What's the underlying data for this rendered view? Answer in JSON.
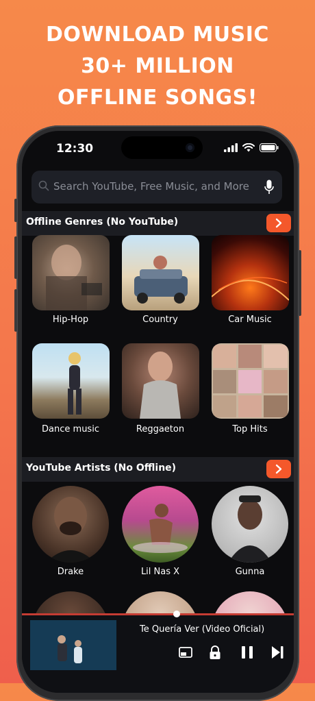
{
  "headline": {
    "line1": "DOWNLOAD MUSIC",
    "line2": "30+ MILLION",
    "line3": "OFFLINE SONGS!"
  },
  "status": {
    "time": "12:30",
    "signal_icon": "signal-icon",
    "wifi_icon": "wifi-icon",
    "battery_icon": "battery-icon"
  },
  "search": {
    "placeholder": "Search YouTube, Free Music, and More",
    "icon": "search-icon",
    "mic_icon": "microphone-icon"
  },
  "genres": {
    "title": "Offline Genres (No YouTube)",
    "items": [
      {
        "label": "Hip-Hop"
      },
      {
        "label": "Country"
      },
      {
        "label": "Car Music"
      },
      {
        "label": "Dance music"
      },
      {
        "label": "Reggaeton"
      },
      {
        "label": "Top Hits"
      }
    ]
  },
  "artists": {
    "title": "YouTube Artists (No Offline)",
    "items": [
      {
        "label": "Drake"
      },
      {
        "label": "Lil Nas X"
      },
      {
        "label": "Gunna"
      }
    ]
  },
  "player": {
    "song_title": "Te Quería Ver (Video Oficial)",
    "progress": 0.57,
    "icons": [
      "pip-icon",
      "lock-icon",
      "pause-icon",
      "skip-next-icon"
    ]
  },
  "colors": {
    "accent": "#f4582b",
    "background_top": "#f6894a",
    "background_bottom": "#ef5f4c",
    "screen": "#0c0c0e"
  }
}
